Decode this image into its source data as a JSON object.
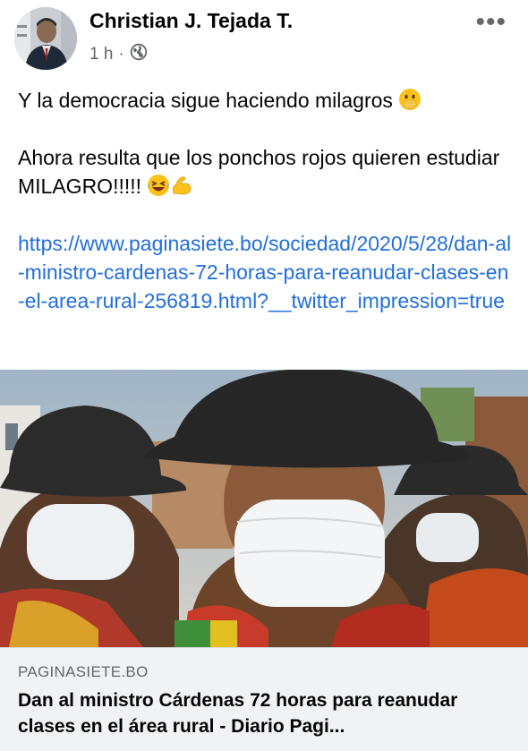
{
  "post": {
    "author": "Christian J. Tejada T.",
    "time": "1 h",
    "separator": "·",
    "privacy_icon": "globe-icon",
    "more_label": "•••",
    "text_line1": "Y la democracia sigue haciendo milagros",
    "text_line2": "Ahora resulta que los ponchos rojos quieren estudiar MILAGRO!!!!!",
    "link": "https://www.paginasiete.bo/sociedad/2020/5/28/dan-al-ministro-cardenas-72-horas-para-reanudar-clases-en-el-area-rural-256819.html?__twitter_impression=true",
    "emojis": [
      "face-with-hand-over-mouth-emoji",
      "rolling-on-floor-laughing-emoji",
      "flexed-biceps-emoji"
    ]
  },
  "link_preview": {
    "domain": "PAGINASIETE.BO",
    "title": "Dan al ministro Cárdenas 72 horas para reanudar clases en el área rural - Diario Pagi..."
  },
  "colors": {
    "link": "#216fdb",
    "secondary_text": "#65676b",
    "card_background": "#f0f2f5"
  }
}
